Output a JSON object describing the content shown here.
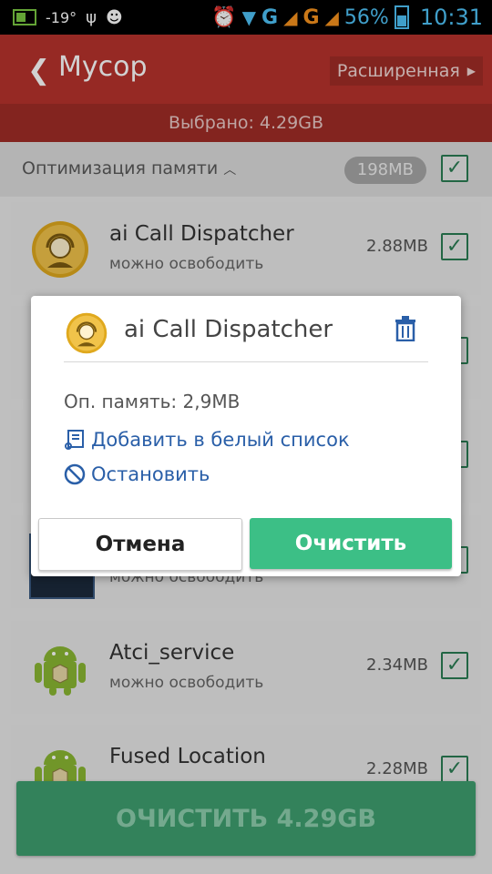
{
  "status_bar": {
    "temp": "-19°",
    "net1": "G",
    "net2": "G",
    "battery_pct": "56%",
    "time": "10:31"
  },
  "header": {
    "title": "Мусор",
    "advanced_label": "Расширенная",
    "selected_text": "Выбрано: 4.29GB"
  },
  "section": {
    "label": "Оптимизация памяти",
    "size": "198MB"
  },
  "rows": [
    {
      "name": "ai Call Dispatcher",
      "sub": "можно освободить",
      "size": "2.88MB",
      "icon": "call-dispatcher-icon"
    },
    {
      "name": "",
      "sub": "можно освободить",
      "size": "",
      "icon": "app-icon"
    },
    {
      "name": "Atci_service",
      "sub": "можно освободить",
      "size": "2.34MB",
      "icon": "android-icon"
    },
    {
      "name": "Fused Location",
      "sub": "",
      "size": "2.28MB",
      "icon": "android-icon"
    }
  ],
  "dialog": {
    "title": "ai Call Dispatcher",
    "memory": "Оп. память: 2,9MB",
    "whitelist": "Добавить в белый список",
    "stop": "Остановить",
    "cancel": "Отмена",
    "clean": "Очистить"
  },
  "bottom_button": "ОЧИСТИТЬ 4.29GB",
  "colors": {
    "header_red": "#b8332c",
    "green": "#3cbf86",
    "link_blue": "#2a5fa8"
  }
}
